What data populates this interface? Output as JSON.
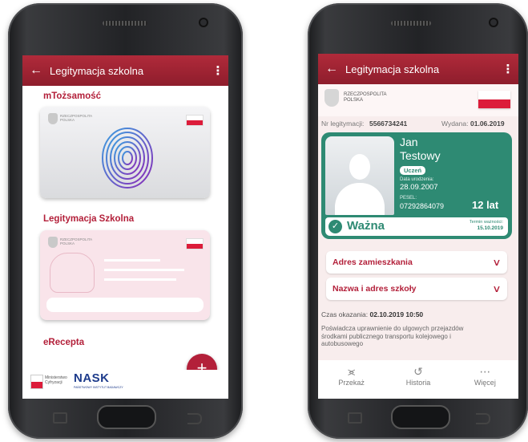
{
  "left_phone": {
    "appbar": {
      "back_icon": "arrow-left-icon",
      "title": "Legitymacja szkolna",
      "menu_icon": "more-vert-icon"
    },
    "sections": {
      "mtozsamosc": "mTożsamość",
      "legitymacja": "Legitymacja Szkolna",
      "erecepta": "eRecepta"
    },
    "card1": {
      "issuer_line1": "RZECZPOSPOLITA",
      "issuer_line2": "POLSKA"
    },
    "card2": {
      "issuer_line1": "RZECZPOSPOLITA",
      "issuer_line2": "POLSKA"
    },
    "footer": {
      "ministry_line1": "Ministerstwo",
      "ministry_line2": "Cyfryzacji",
      "nask": "NASK",
      "nask_sub": "PAŃSTWOWY INSTYTUT BADAWCZY"
    },
    "fab_label": "+"
  },
  "right_phone": {
    "appbar": {
      "back_icon": "arrow-left-icon",
      "title": "Legitymacja szkolna",
      "menu_icon": "more-vert-icon"
    },
    "header": {
      "line1": "RZECZPOSPOLITA",
      "line2": "POLSKA"
    },
    "meta": {
      "nr_label": "Nr legitymacji:",
      "nr_value": "5566734241",
      "issued_label": "Wydana:",
      "issued_value": "01.06.2019"
    },
    "card": {
      "first_name": "Jan",
      "last_name": "Testowy",
      "role_badge": "Uczeń",
      "dob_label": "Data urodzenia:",
      "dob_value": "28.09.2007",
      "pesel_label": "PESEL:",
      "pesel_value": "07292864079",
      "age": "12 lat",
      "status": "Ważna",
      "validity_label": "Termin ważności:",
      "validity_value": "15.10.2019"
    },
    "accordions": [
      {
        "label": "Adres zamieszkania"
      },
      {
        "label": "Nazwa i adres szkoły"
      }
    ],
    "shown_label": "Czas okazania:",
    "shown_value": "02.10.2019 10:50",
    "description": "Poświadcza uprawnienie do ulgowych przejazdów środkami publicznego transportu kolejowego i autobusowego",
    "bottom_nav": [
      {
        "label": "Przekaż",
        "icon": "share-icon"
      },
      {
        "label": "Historia",
        "icon": "history-icon"
      },
      {
        "label": "Więcej",
        "icon": "more-horiz-icon"
      }
    ]
  },
  "colors": {
    "brand_red": "#b3203a",
    "card_green": "#2e8a73",
    "pink_bg": "#f8eded"
  }
}
